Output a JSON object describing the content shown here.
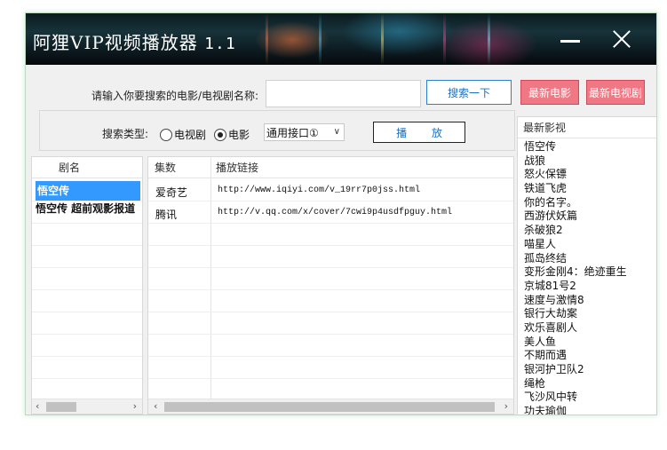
{
  "window": {
    "title": "阿狸VIP视频播放器",
    "version": "1.1"
  },
  "search": {
    "label": "请输入你要搜索的电影/电视剧名称:",
    "value": "",
    "placeholder": "",
    "button": "搜索一下"
  },
  "buttons": {
    "new_movies": "最新电影",
    "new_tv": "最新电视剧",
    "play": "播 放"
  },
  "search_type": {
    "label": "搜索类型:",
    "options": [
      {
        "label": "电视剧",
        "selected": false
      },
      {
        "label": "电影",
        "selected": true
      }
    ],
    "api": "通用接口①"
  },
  "names_panel": {
    "header": "剧名",
    "items": [
      {
        "label": "悟空传",
        "selected": true
      },
      {
        "label": "悟空传  超前观影报道",
        "selected": false
      }
    ]
  },
  "links_panel": {
    "headers": [
      "集数",
      "播放链接"
    ],
    "rows": [
      {
        "source": "爱奇艺",
        "url": "http://www.iqiyi.com/v_19rr7p0jss.html"
      },
      {
        "source": "腾讯",
        "url": "http://v.qq.com/x/cover/7cwi9p4usdfpguy.html"
      }
    ]
  },
  "latest_panel": {
    "header": "最新影视",
    "items": [
      "悟空传",
      "战狼",
      "怒火保镖",
      "铁道飞虎",
      "你的名字。",
      "西游伏妖篇",
      "杀破狼2",
      "喵星人",
      "孤岛终结",
      "变形金刚4：绝迹重生",
      "京城81号2",
      "速度与激情8",
      "银行大劫案",
      "欢乐喜剧人",
      "美人鱼",
      "不期而遇",
      "银河护卫队2",
      "绳枪",
      "飞沙风中转",
      "功夫瑜伽"
    ]
  },
  "colors": {
    "accent_blue": "#3399ff",
    "button_pink": "#f07884",
    "link_blue": "#1a6fc0"
  }
}
